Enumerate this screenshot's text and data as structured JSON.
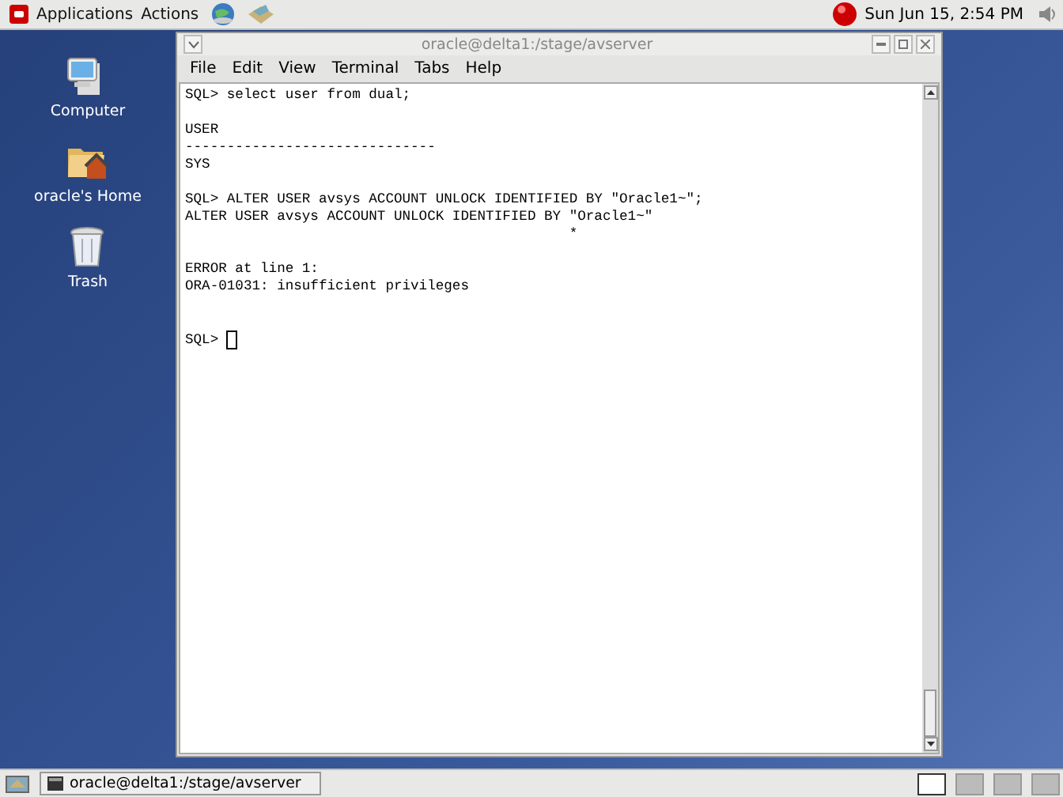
{
  "top_panel": {
    "menus": [
      "Applications",
      "Actions"
    ],
    "clock": "Sun Jun 15,  2:54 PM"
  },
  "desktop_icons": [
    {
      "label": "Computer",
      "kind": "computer"
    },
    {
      "label": "oracle's Home",
      "kind": "home"
    },
    {
      "label": "Trash",
      "kind": "trash"
    }
  ],
  "window": {
    "title": "oracle@delta1:/stage/avserver",
    "menu": [
      "File",
      "Edit",
      "View",
      "Terminal",
      "Tabs",
      "Help"
    ],
    "blocks": [
      [
        "SQL> select user from dual;"
      ],
      [
        "USER",
        "------------------------------",
        "SYS"
      ],
      [
        "SQL> ALTER USER avsys ACCOUNT UNLOCK IDENTIFIED BY \"Oracle1~\";",
        "ALTER USER avsys ACCOUNT UNLOCK IDENTIFIED BY \"Oracle1~\"",
        "                                              *"
      ],
      [
        "ERROR at line 1:",
        "ORA-01031: insufficient privileges"
      ]
    ],
    "prompt": "SQL>"
  },
  "taskbar": {
    "tasks": [
      {
        "label": "oracle@delta1:/stage/avserver",
        "selected": false
      }
    ],
    "workspaces": [
      {
        "selected": true
      },
      {
        "selected": false
      },
      {
        "selected": false
      },
      {
        "selected": false
      }
    ]
  }
}
